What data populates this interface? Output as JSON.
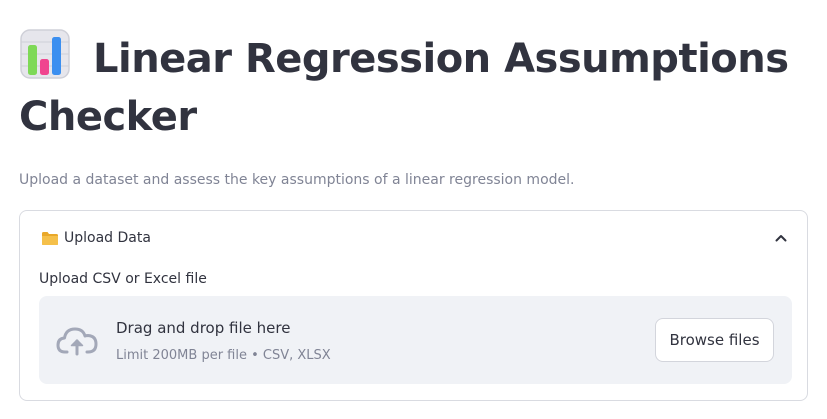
{
  "header": {
    "title": "Linear Regression Assumptions Checker",
    "title_icon": "bar-chart-emoji-icon",
    "subtitle": "Upload a dataset and assess the key assumptions of a linear regression model."
  },
  "expander": {
    "icon": "folder-icon",
    "label": "Upload Data",
    "state": "expanded",
    "toggle_icon": "chevron-up-icon"
  },
  "uploader": {
    "label": "Upload CSV or Excel file",
    "icon": "cloud-upload-icon",
    "drag_text": "Drag and drop file here",
    "limit_text": "Limit 200MB per file • CSV, XLSX",
    "browse_label": "Browse files"
  },
  "colors": {
    "text": "#31333f",
    "muted": "#808495",
    "dropzone_bg": "#f0f2f6",
    "border": "#d9dbe1",
    "icon_gray": "#a3a8b8",
    "folder": "#f5c04a"
  }
}
